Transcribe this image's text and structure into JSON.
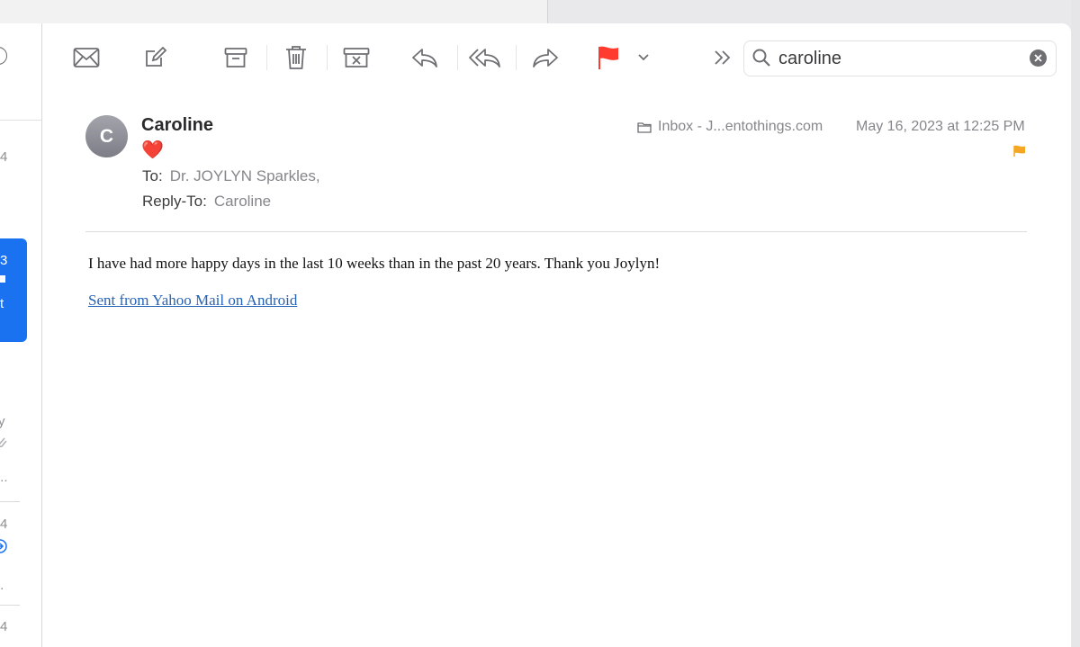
{
  "toolbar": {
    "icons": [
      "envelope-icon",
      "compose-icon",
      "archive-icon",
      "trash-icon",
      "junk-icon",
      "reply-icon",
      "reply-all-icon",
      "forward-icon",
      "flag-icon",
      "chevron-down-icon",
      "more-icon"
    ],
    "flag_color": "#ff3b30",
    "search": {
      "value": "caroline"
    }
  },
  "sidebar": {
    "fragments": [
      "4",
      "3",
      "t",
      "y",
      "...",
      "4",
      "..",
      "4"
    ]
  },
  "message": {
    "avatar_initial": "C",
    "sender": "Caroline",
    "subject": "❤️",
    "to_label": "To:",
    "to_value": "Dr. JOYLYN Sparkles,",
    "reply_to_label": "Reply-To:",
    "reply_to_value": "Caroline",
    "mailbox": "Inbox - J...entothings.com",
    "date": "May 16, 2023 at 12:25 PM",
    "flag_color": "#f5a623",
    "body": "I have had more happy days in the last 10 weeks than in the past 20 years.  Thank you Joylyn!",
    "signature_link": "Sent from Yahoo Mail on Android"
  },
  "colors": {
    "accent": "#1a72f0",
    "link": "#2563b8"
  }
}
